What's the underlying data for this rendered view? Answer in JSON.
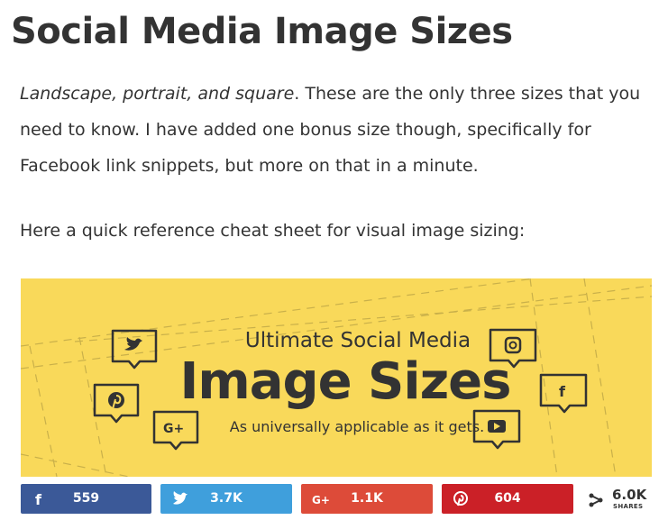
{
  "article": {
    "title": "Social Media Image Sizes",
    "intro_italic": "Landscape, portrait, and square",
    "intro_rest": ". These are the only three sizes that you need to know. I have added one bonus size though, specifically for Facebook link snippets, but more on that in a minute.",
    "reference_line": "Here a quick reference cheat sheet for visual image sizing:"
  },
  "banner": {
    "kicker": "Ultimate Social Media",
    "title": "Image Sizes",
    "subtitle": "As universally applicable as it gets.",
    "background_color": "#f9d95a",
    "icons": [
      "twitter-icon",
      "pinterest-icon",
      "google-plus-icon",
      "instagram-icon",
      "facebook-icon",
      "youtube-icon"
    ]
  },
  "share_bar": {
    "buttons": [
      {
        "network": "facebook",
        "icon": "facebook-icon",
        "count": "559",
        "color": "#3b5998"
      },
      {
        "network": "twitter",
        "icon": "twitter-icon",
        "count": "3.7K",
        "color": "#3f9fdc"
      },
      {
        "network": "google-plus",
        "icon": "google-plus-icon",
        "count": "1.1K",
        "color": "#dd4b39"
      },
      {
        "network": "pinterest",
        "icon": "pinterest-icon",
        "count": "604",
        "color": "#cb2027"
      }
    ],
    "total_count": "6.0K",
    "total_label": "SHARES"
  }
}
